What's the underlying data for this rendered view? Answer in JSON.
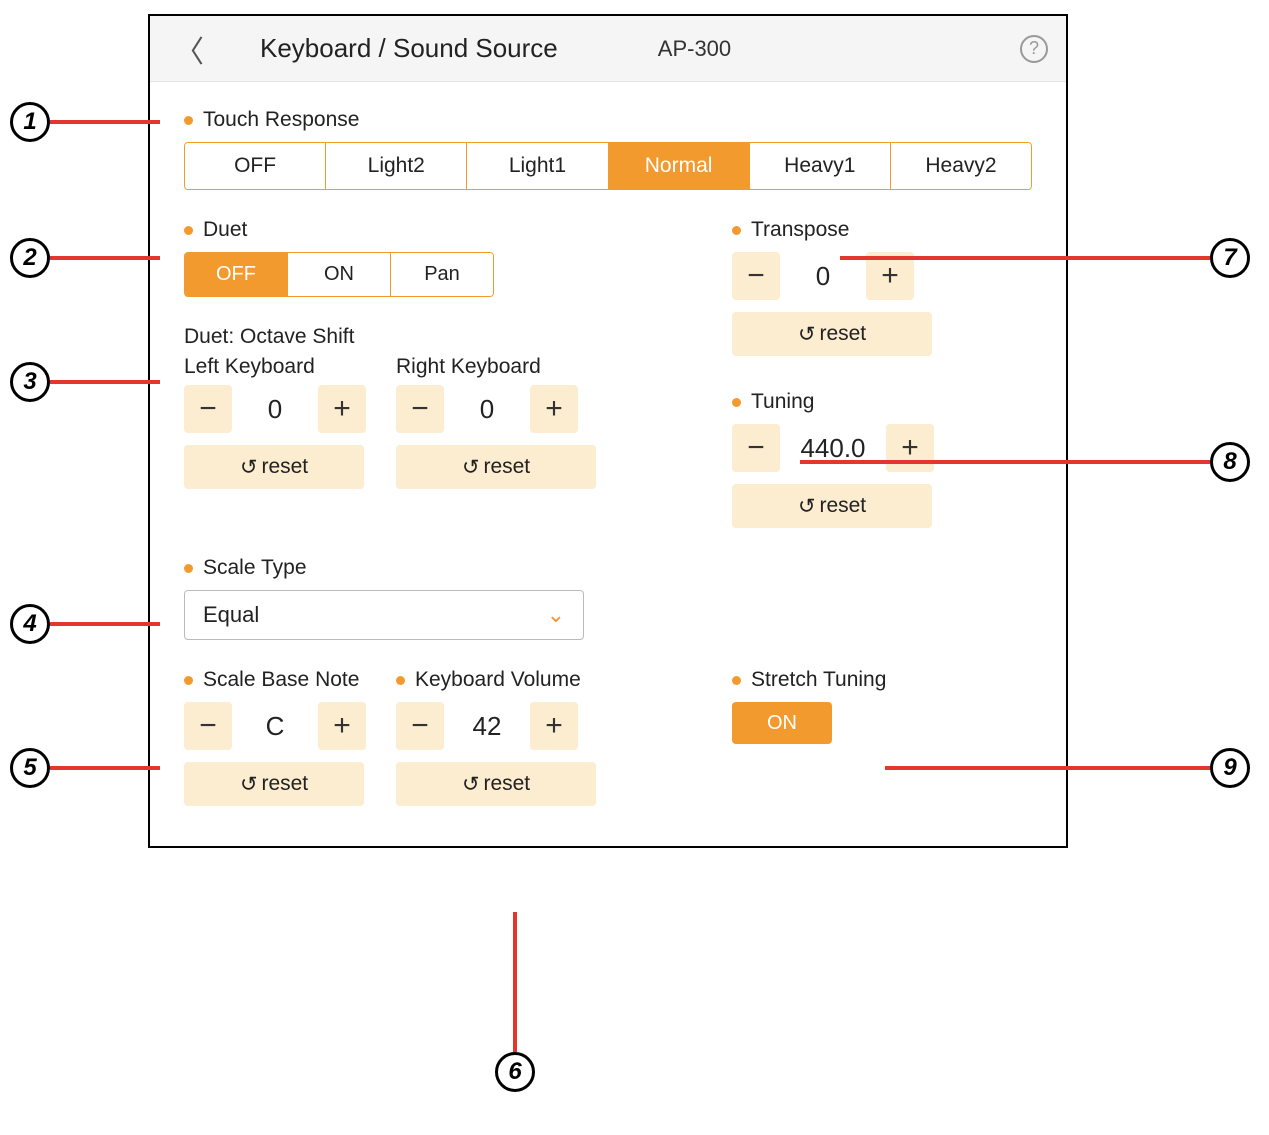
{
  "header": {
    "title": "Keyboard / Sound Source",
    "model": "AP-300"
  },
  "touch_response": {
    "label": "Touch Response",
    "options": [
      "OFF",
      "Light2",
      "Light1",
      "Normal",
      "Heavy1",
      "Heavy2"
    ],
    "selected": "Normal"
  },
  "duet": {
    "label": "Duet",
    "options": [
      "OFF",
      "ON",
      "Pan"
    ],
    "selected": "OFF"
  },
  "duet_octave": {
    "label": "Duet: Octave Shift",
    "left_label": "Left Keyboard",
    "right_label": "Right Keyboard",
    "left_value": "0",
    "right_value": "0",
    "reset_label": "reset"
  },
  "scale_type": {
    "label": "Scale Type",
    "value": "Equal"
  },
  "scale_base_note": {
    "label": "Scale Base Note",
    "value": "C",
    "reset_label": "reset"
  },
  "keyboard_volume": {
    "label": "Keyboard Volume",
    "value": "42",
    "reset_label": "reset"
  },
  "transpose": {
    "label": "Transpose",
    "value": "0",
    "reset_label": "reset"
  },
  "tuning": {
    "label": "Tuning",
    "value": "440.0",
    "reset_label": "reset"
  },
  "stretch_tuning": {
    "label": "Stretch Tuning",
    "value": "ON"
  },
  "callouts": [
    "1",
    "2",
    "3",
    "4",
    "5",
    "6",
    "7",
    "8",
    "9"
  ]
}
